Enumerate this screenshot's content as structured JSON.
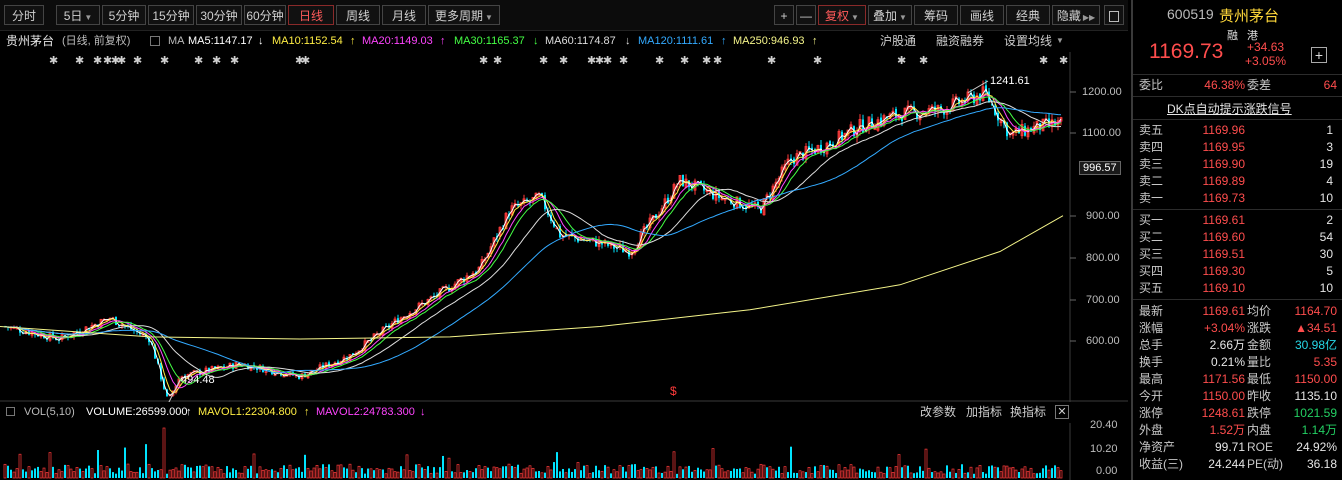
{
  "toolbar": {
    "left_buttons": [
      "分时",
      "5日",
      "5分钟",
      "15分钟",
      "30分钟",
      "60分钟",
      "日线",
      "周线",
      "月线",
      "更多周期"
    ],
    "right_buttons": [
      "+",
      "—",
      "复权",
      "叠加",
      "筹码",
      "画线",
      "经典",
      "隐藏"
    ],
    "active": "日线"
  },
  "infobar": {
    "name": "贵州茅台",
    "mode": "(日线, 前复权)",
    "ma_label": "MA",
    "ma5": "MA5:1147.17",
    "ma10": "MA10:1152.54",
    "ma20": "MA20:1149.03",
    "ma30": "MA30:1165.37",
    "ma60": "MA60:1174.87",
    "ma120": "MA120:1111.61",
    "ma250": "MA250:946.93",
    "link1": "沪股通",
    "link2": "融资融券",
    "link3": "设置均线"
  },
  "axis": {
    "price_ticks": [
      "1200.00",
      "1100.00",
      "996.57",
      "900.00",
      "800.00",
      "700.00",
      "600.00"
    ],
    "vol_ticks": [
      "20.40",
      "10.20",
      "0.00"
    ]
  },
  "annotations": {
    "high": "1241.61",
    "low": "494.48",
    "dollar": "$"
  },
  "volbar": {
    "label": "VOL(5,10)",
    "volume": "VOLUME:26599.000",
    "mavol1": "MAVOL1:22304.800",
    "mavol2": "MAVOL2:24783.300",
    "btn1": "改参数",
    "btn2": "加指标",
    "btn3": "换指标"
  },
  "colors": {
    "up": "#ff3b3b",
    "down": "#00e4ff",
    "ma5": "#ffffff",
    "ma10": "#ffee44",
    "ma20": "#ff44ff",
    "ma30": "#44ff44",
    "ma60": "#dddddd",
    "ma120": "#33aaff",
    "ma250": "#f5f58a"
  },
  "quote": {
    "code": "600519",
    "name": "贵州茅台",
    "tag1": "融",
    "tag2": "港",
    "price": "1169.73",
    "change": "+34.63",
    "pct": "+3.05%",
    "weibi_label": "委比",
    "weibi": "46.38%",
    "weicha_label": "委差",
    "weicha": "64",
    "signal": "DK点自动提示涨跌信号"
  },
  "asks": [
    {
      "label": "卖五",
      "price": "1169.96",
      "vol": "1"
    },
    {
      "label": "卖四",
      "price": "1169.95",
      "vol": "3"
    },
    {
      "label": "卖三",
      "price": "1169.90",
      "vol": "19"
    },
    {
      "label": "卖二",
      "price": "1169.89",
      "vol": "4"
    },
    {
      "label": "卖一",
      "price": "1169.73",
      "vol": "10"
    }
  ],
  "bids": [
    {
      "label": "买一",
      "price": "1169.61",
      "vol": "2"
    },
    {
      "label": "买二",
      "price": "1169.60",
      "vol": "54"
    },
    {
      "label": "买三",
      "price": "1169.51",
      "vol": "30"
    },
    {
      "label": "买四",
      "price": "1169.30",
      "vol": "5"
    },
    {
      "label": "买五",
      "price": "1169.10",
      "vol": "10"
    }
  ],
  "stats": [
    {
      "l1": "最新",
      "v1": "1169.61",
      "c1": "red",
      "l2": "均价",
      "v2": "1164.70",
      "c2": "red"
    },
    {
      "l1": "涨幅",
      "v1": "+3.04%",
      "c1": "red",
      "l2": "涨跌",
      "v2": "▲34.51",
      "c2": "red"
    },
    {
      "l1": "总手",
      "v1": "2.66万",
      "c1": "white",
      "l2": "金额",
      "v2": "30.98亿",
      "c2": "cyan"
    },
    {
      "l1": "换手",
      "v1": "0.21%",
      "c1": "white",
      "l2": "量比",
      "v2": "5.35",
      "c2": "red"
    },
    {
      "l1": "最高",
      "v1": "1171.56",
      "c1": "red",
      "l2": "最低",
      "v2": "1150.00",
      "c2": "red"
    },
    {
      "l1": "今开",
      "v1": "1150.00",
      "c1": "red",
      "l2": "昨收",
      "v2": "1135.10",
      "c2": "white"
    },
    {
      "l1": "涨停",
      "v1": "1248.61",
      "c1": "red",
      "l2": "跌停",
      "v2": "1021.59",
      "c2": "green"
    },
    {
      "l1": "外盘",
      "v1": "1.52万",
      "c1": "red",
      "l2": "内盘",
      "v2": "1.14万",
      "c2": "green"
    },
    {
      "l1": "净资产",
      "v1": "99.71",
      "c1": "white",
      "l2": "ROE",
      "v2": "24.92%",
      "c2": "white"
    },
    {
      "l1": "收益(三)",
      "v1": "24.244",
      "c1": "white",
      "l2": "PE(动)",
      "v2": "36.18",
      "c2": "white"
    }
  ]
}
